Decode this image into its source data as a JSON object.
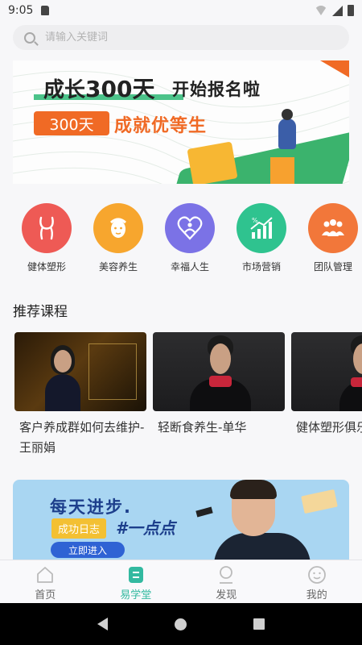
{
  "status": {
    "time": "9:05"
  },
  "search": {
    "placeholder": "请输入关键词"
  },
  "banner": {
    "title_part1": "成长",
    "title_number": "300天",
    "subtitle": "开始报名啦",
    "pill": "300天",
    "tagline": "成就优等生"
  },
  "categories": [
    {
      "label": "健体塑形",
      "color": "#ee5a55",
      "icon": "body-icon"
    },
    {
      "label": "美容养生",
      "color": "#f7a62e",
      "icon": "face-mask-icon"
    },
    {
      "label": "幸福人生",
      "color": "#7b72e6",
      "icon": "heart-person-icon"
    },
    {
      "label": "市场营销",
      "color": "#2fc38f",
      "icon": "growth-chart-icon"
    },
    {
      "label": "团队管理",
      "color": "#f2773a",
      "icon": "team-icon"
    }
  ],
  "section": {
    "recommended_title": "推荐课程"
  },
  "courses": [
    {
      "title": "客户养成群如何去维护-王丽娟"
    },
    {
      "title": "轻断食养生-单华"
    },
    {
      "title": "健体塑形俱乐部-刘翠婴"
    }
  ],
  "promo": {
    "headline": "每天进步.",
    "badge": "成功日志",
    "slogan": "#一点点",
    "button": "立即进入"
  },
  "bottom_nav": [
    {
      "label": "首页",
      "icon": "home-icon",
      "active": false
    },
    {
      "label": "易学堂",
      "icon": "book-icon",
      "active": true
    },
    {
      "label": "发现",
      "icon": "discover-icon",
      "active": false
    },
    {
      "label": "我的",
      "icon": "smiley-icon",
      "active": false
    }
  ],
  "colors": {
    "accent": "#32b9a0",
    "orange": "#f06a25",
    "green": "#4cc38a"
  }
}
